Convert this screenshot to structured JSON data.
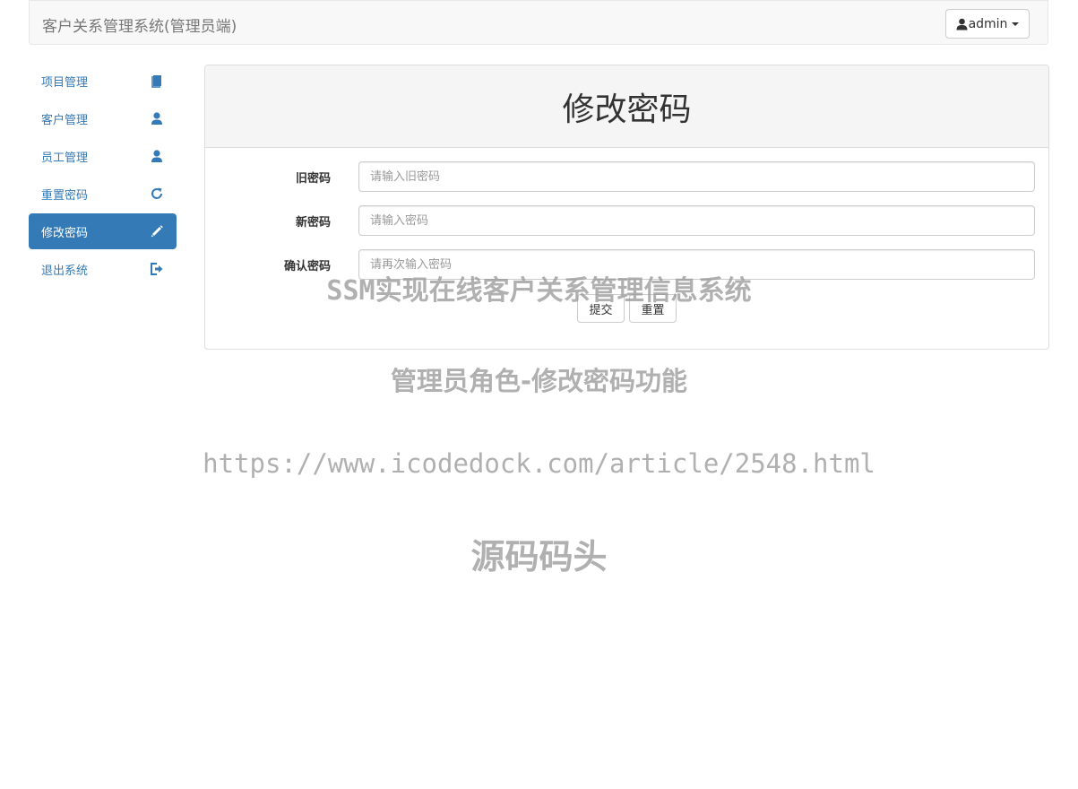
{
  "header": {
    "brand": "客户关系管理系统(管理员端)",
    "user": "admin"
  },
  "sidebar": {
    "items": [
      {
        "label": "项目管理",
        "icon": "book-icon"
      },
      {
        "label": "客户管理",
        "icon": "user-icon"
      },
      {
        "label": "员工管理",
        "icon": "user-icon"
      },
      {
        "label": "重置密码",
        "icon": "refresh-icon"
      },
      {
        "label": "修改密码",
        "icon": "pencil-icon",
        "active": true
      },
      {
        "label": "退出系统",
        "icon": "logout-icon"
      }
    ]
  },
  "main": {
    "title": "修改密码",
    "fields": [
      {
        "label": "旧密码",
        "placeholder": "请输入旧密码"
      },
      {
        "label": "新密码",
        "placeholder": "请输入密码"
      },
      {
        "label": "确认密码",
        "placeholder": "请再次输入密码"
      }
    ],
    "submit_label": "提交",
    "reset_label": "重置"
  },
  "watermarks": {
    "line1": "SSM实现在线客户关系管理信息系统",
    "line2": "管理员角色-修改密码功能",
    "line3": "https://www.icodedock.com/article/2548.html",
    "line4": "源码码头"
  },
  "colors": {
    "accent": "#337ab7",
    "navbar_bg": "#f8f8f8",
    "panel_head_bg": "#f5f5f5"
  }
}
